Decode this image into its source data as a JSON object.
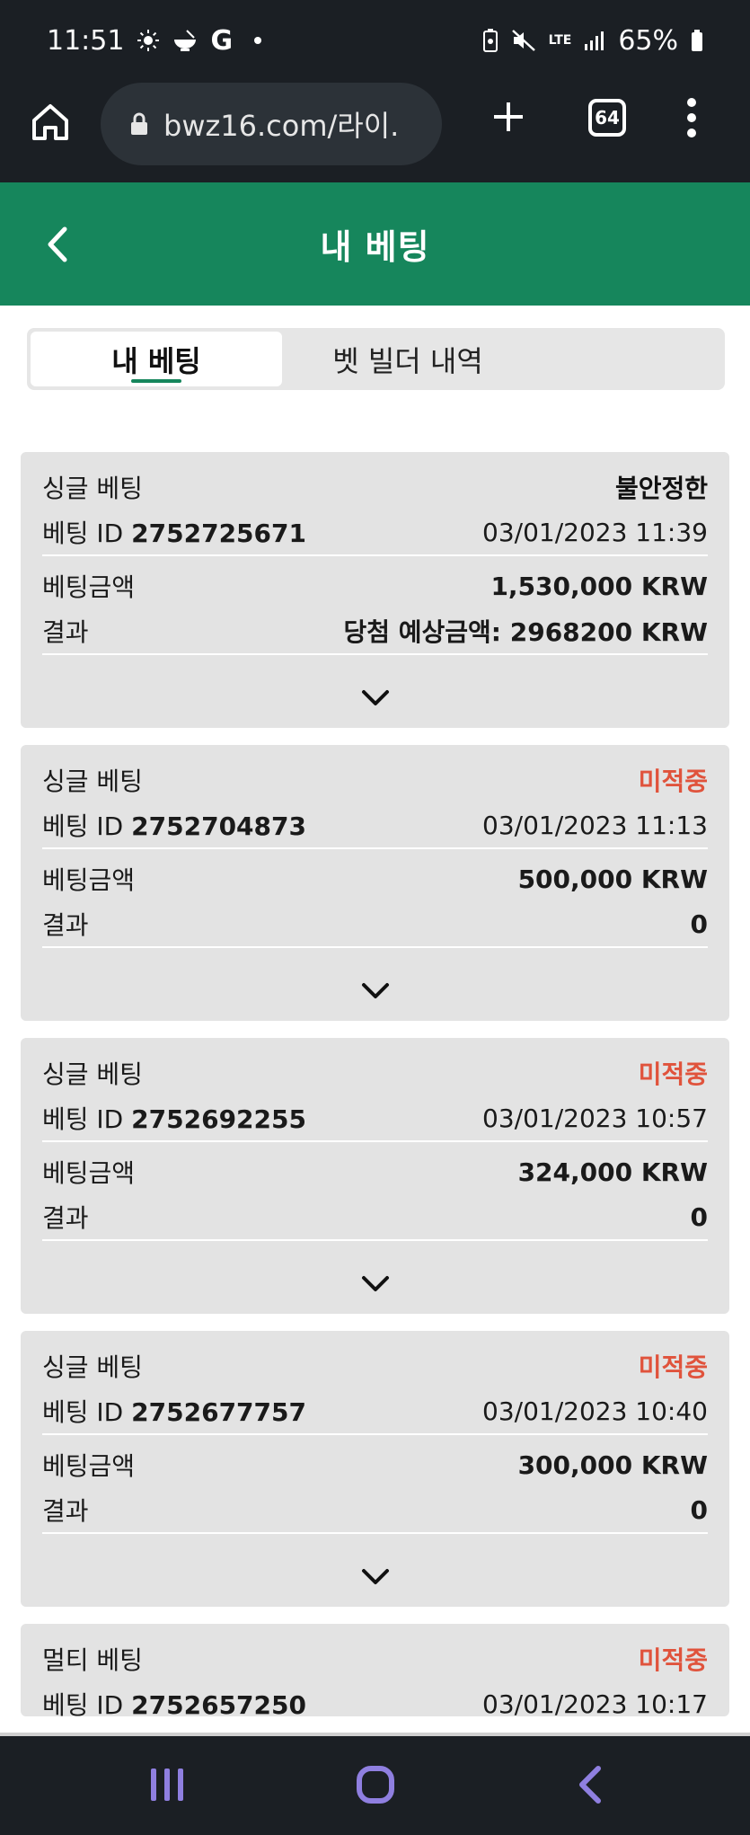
{
  "status_bar": {
    "time": "11:51",
    "g_label": "G",
    "network": "LTE",
    "battery": "65%"
  },
  "browser": {
    "url": "bwz16.com/라이.",
    "tab_count": "64"
  },
  "header": {
    "title": "내 베팅"
  },
  "tabs": [
    {
      "label": "내 베팅",
      "active": true
    },
    {
      "label": "벳 빌더 내역",
      "active": false
    }
  ],
  "bets": [
    {
      "type": "싱글 베팅",
      "status": "불안정한",
      "id_label": "베팅 ID",
      "id": "2752725671",
      "datetime": "03/01/2023 11:39",
      "amount_label": "베팅금액",
      "amount": "1,530,000 KRW",
      "result_label": "결과",
      "result": "당첨 예상금액: 2968200 KRW"
    },
    {
      "type": "싱글 베팅",
      "status": "미적중",
      "id_label": "베팅 ID",
      "id": "2752704873",
      "datetime": "03/01/2023 11:13",
      "amount_label": "베팅금액",
      "amount": "500,000 KRW",
      "result_label": "결과",
      "result": "0"
    },
    {
      "type": "싱글 베팅",
      "status": "미적중",
      "id_label": "베팅 ID",
      "id": "2752692255",
      "datetime": "03/01/2023 10:57",
      "amount_label": "베팅금액",
      "amount": "324,000 KRW",
      "result_label": "결과",
      "result": "0"
    },
    {
      "type": "싱글 베팅",
      "status": "미적중",
      "id_label": "베팅 ID",
      "id": "2752677757",
      "datetime": "03/01/2023 10:40",
      "amount_label": "베팅금액",
      "amount": "300,000 KRW",
      "result_label": "결과",
      "result": "0"
    },
    {
      "type": "멀티 베팅",
      "status": "미적중",
      "id_label": "베팅 ID",
      "id": "2752657250",
      "datetime": "03/01/2023 10:17"
    }
  ],
  "colors": {
    "header_green": "#16865c",
    "status_red": "#e0533c",
    "chrome_dark": "#1b1f24",
    "card_bg": "#e3e3e3"
  },
  "icons": [
    "home-icon",
    "lock-icon",
    "plus-icon",
    "tabs-icon",
    "more-vert-icon",
    "back-arrow-icon",
    "chevron-down-icon",
    "recent-apps-icon",
    "home-nav-icon",
    "back-nav-icon"
  ]
}
